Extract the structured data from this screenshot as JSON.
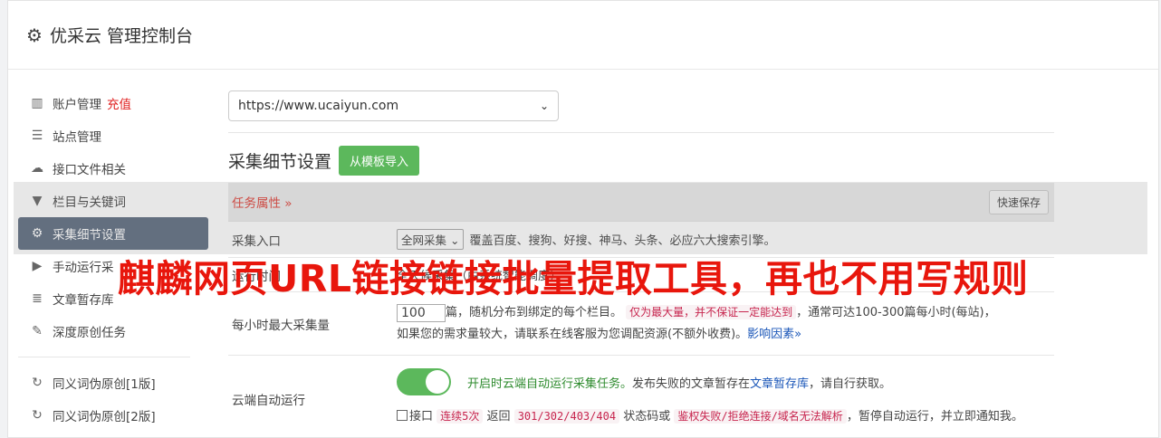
{
  "header": {
    "title": "优采云 管理控制台"
  },
  "sidebar": {
    "items": [
      {
        "label": "账户管理",
        "extra": "充值",
        "icon": "bar-chart-icon"
      },
      {
        "label": "站点管理",
        "icon": "server-icon"
      },
      {
        "label": "接口文件相关",
        "icon": "cloud-upload-icon"
      },
      {
        "label": "栏目与关键词",
        "icon": "filter-icon"
      },
      {
        "label": "采集细节设置",
        "icon": "cogs-icon",
        "active": true
      },
      {
        "label": "手动运行采",
        "icon": "play-circle-icon"
      },
      {
        "label": "文章暂存库",
        "icon": "database-icon"
      },
      {
        "label": "深度原创任务",
        "icon": "edit-icon"
      },
      {
        "label": "同义词伪原创[1版]",
        "icon": "refresh-icon"
      },
      {
        "label": "同义词伪原创[2版]",
        "icon": "refresh-icon"
      }
    ]
  },
  "main": {
    "site_select_value": "https://www.ucaiyun.com",
    "section_title": "采集细节设置",
    "import_button": "从模板导入",
    "task_properties": "任务属性 »",
    "quick_save": "快速保存",
    "collect_entry": {
      "label": "采集入口",
      "select_value": "全网采集",
      "desc": "覆盖百度、搜狗、好搜、神马、头条、必应六大搜索引擎。"
    },
    "run_time": {
      "label": "运行时间",
      "desc": "全天候采集（由系统智能调度）"
    },
    "max_per_hour": {
      "label": "每小时最大采集量",
      "value": "100",
      "desc1": "篇，随机分布到绑定的每个栏目。",
      "note": "仅为最大量，并不保证一定能达到",
      "desc2": "，通常可达100-300篇每小时(每站)，",
      "desc3": "如果您的需求量较大，请联系在线客服为您调配资源(不额外收费)。",
      "link": "影响因素»"
    },
    "cloud_run": {
      "label": "云端自动运行",
      "toggle_state": "on",
      "enabled_text": "开启时云端自动运行采集任务。",
      "desc": "发布失败的文章暂存在",
      "link": "文章暂存库",
      "desc_end": "，请自行获取。",
      "cb_text1": "接口",
      "code1": "连续5次",
      "cb_text2": "返回",
      "code2": "301/302/403/404",
      "cb_text3": "状态码或",
      "code3": "鉴权失败/拒绝连接/域名无法解析",
      "cb_text4": "，暂停自动运行，并立即通知我。"
    }
  },
  "watermark": "麒麟网页URL链接链接批量提取工具，再也不用写规则",
  "colors": {
    "accent_green": "#5cb85c",
    "active_nav": "#5f6d80",
    "warning_red": "#e02020",
    "watermark_red": "#e8160c"
  }
}
